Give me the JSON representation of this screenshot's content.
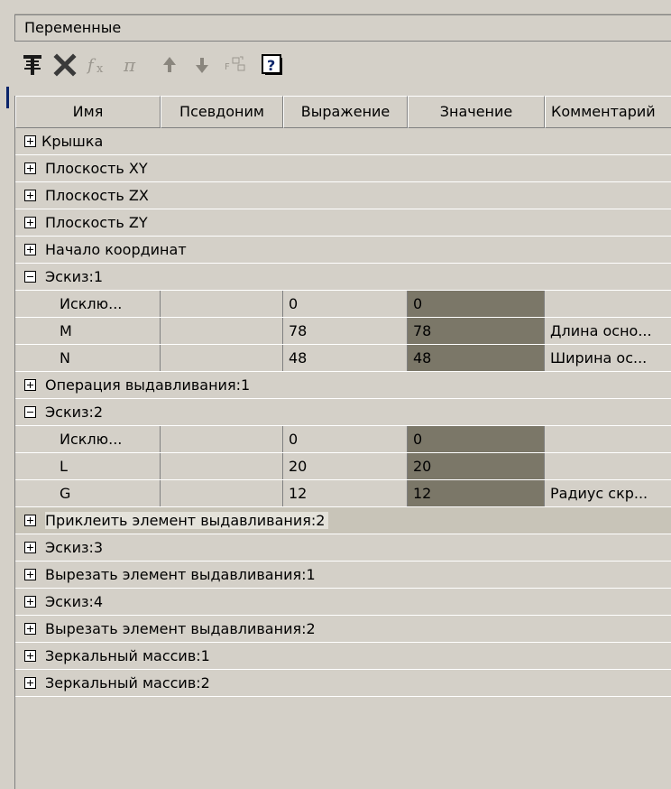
{
  "panel": {
    "title": "Переменные"
  },
  "toolbar": {
    "buttons": [
      {
        "icon": "insert-variable-icon",
        "enabled": true
      },
      {
        "icon": "delete-icon",
        "enabled": true
      },
      {
        "icon": "function-icon",
        "enabled": false
      },
      {
        "icon": "pi-icon",
        "enabled": false
      },
      {
        "icon": "move-up-icon",
        "enabled": false
      },
      {
        "icon": "move-down-icon",
        "enabled": false
      },
      {
        "icon": "filter-icon",
        "enabled": false
      },
      {
        "icon": "help-icon",
        "enabled": true
      }
    ]
  },
  "table": {
    "columns": [
      "Имя",
      "Псевдоним",
      "Выражение",
      "Значение",
      "Комментарий"
    ],
    "groups": {
      "g1": "Крышка",
      "g2": "Плоскость XY",
      "g3": "Плоскость ZX",
      "g4": "Плоскость ZY",
      "g5": "Начало координат",
      "g6": "Эскиз:1",
      "g7": "Операция выдавливания:1",
      "g8": "Эскиз:2",
      "g9": "Приклеить элемент выдавливания:2",
      "g10": "Эскиз:3",
      "g11": "Вырезать элемент выдавливания:1",
      "g12": "Эскиз:4",
      "g13": "Вырезать элемент выдавливания:2",
      "g14": "Зеркальный массив:1",
      "g15": "Зеркальный массив:2"
    },
    "sketch1": [
      {
        "name": "Исклю...",
        "alias": "",
        "expr": "0",
        "value": "0",
        "comment": ""
      },
      {
        "name": "M",
        "alias": "",
        "expr": "78",
        "value": "78",
        "comment": "Длина осно..."
      },
      {
        "name": "N",
        "alias": "",
        "expr": "48",
        "value": "48",
        "comment": "Ширина ос..."
      }
    ],
    "sketch2": [
      {
        "name": "Исклю...",
        "alias": "",
        "expr": "0",
        "value": "0",
        "comment": ""
      },
      {
        "name": "L",
        "alias": "",
        "expr": "20",
        "value": "20",
        "comment": ""
      },
      {
        "name": "G",
        "alias": "",
        "expr": "12",
        "value": "12",
        "comment": "Радиус скр..."
      }
    ]
  },
  "colors": {
    "value_cell_bg": "#7b7768",
    "panel_bg": "#d4d0c8",
    "selection_accent": "#0a246a"
  }
}
